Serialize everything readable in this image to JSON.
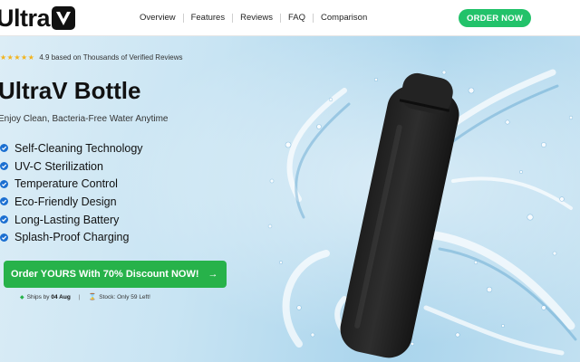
{
  "brand": {
    "logo_text": "Ultra",
    "logo_icon": "v-badge-icon"
  },
  "nav": {
    "links": [
      "Overview",
      "Features",
      "Reviews",
      "FAQ",
      "Comparison"
    ],
    "order_button": "ORDER NOW"
  },
  "hero": {
    "rating_text": "4.9 based on Thousands of Verified Reviews",
    "stars": "★★★★★",
    "title": "UltraV Bottle",
    "subtitle": "Enjoy Clean, Bacteria-Free Water Anytime",
    "features": [
      "Self-Cleaning Technology",
      "UV-C Sterilization",
      "Temperature Control",
      "Eco-Friendly Design",
      "Long-Lasting Battery",
      "Splash-Proof Charging"
    ],
    "cta_label": "Order YOURS With 70% Discount NOW!",
    "cta_arrow": "→",
    "ships_prefix": "Ships by",
    "ships_date": "04 Aug",
    "stock_prefix": "Stock:",
    "stock_text": "Only 59 Left!"
  },
  "colors": {
    "order_green": "#22c26a",
    "cta_green": "#27b24a",
    "check_blue": "#1b6fd1",
    "star_gold": "#f2b31c"
  }
}
